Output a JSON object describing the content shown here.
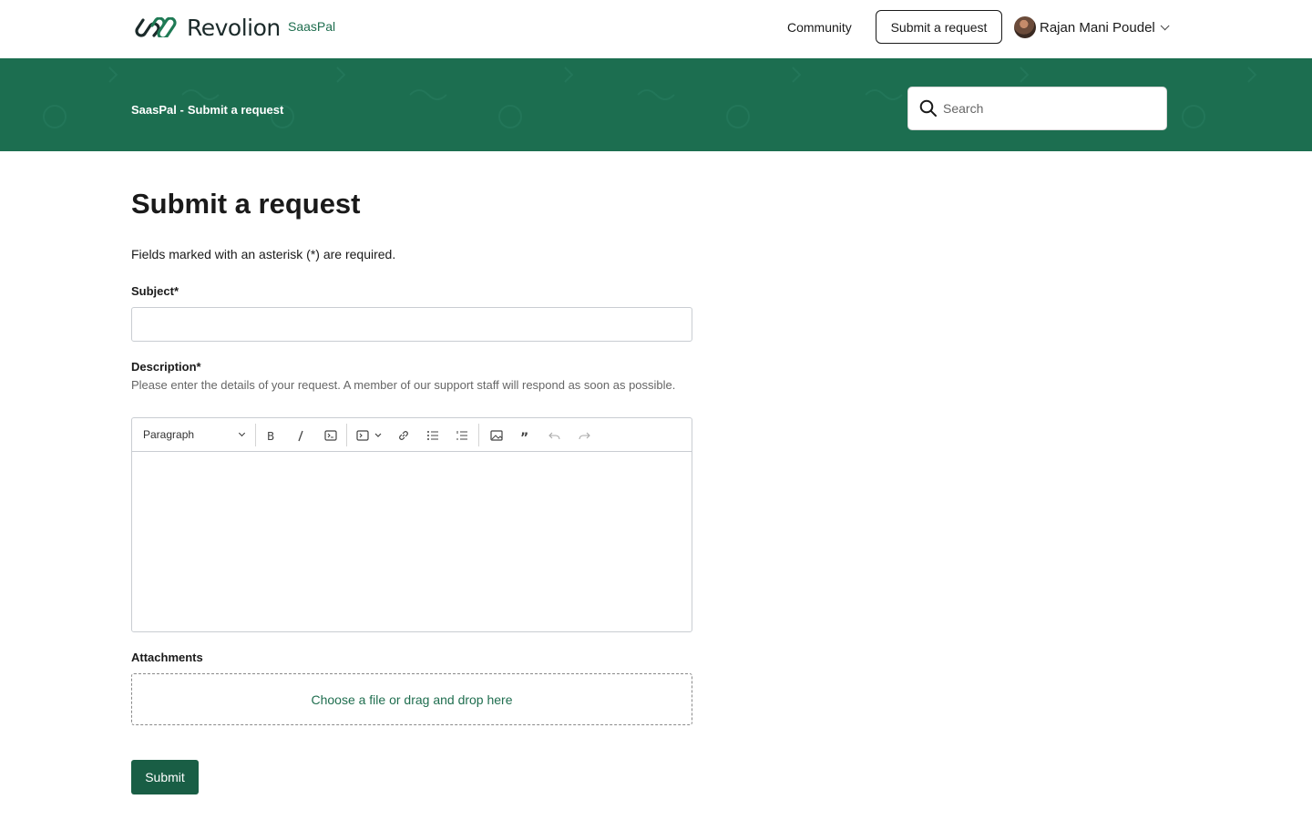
{
  "header": {
    "logo_text": "Revolion",
    "brand_link": "SaasPal",
    "community_link": "Community",
    "submit_request_button": "Submit a request",
    "user_name": "Rajan Mani Poudel"
  },
  "banner": {
    "breadcrumb": [
      "SaasPal -",
      "Submit a request"
    ],
    "search_placeholder": "Search"
  },
  "main": {
    "title": "Submit a request",
    "required_note": "Fields marked with an asterisk (*) are required.",
    "subject_label": "Subject*",
    "subject_value": "",
    "description_label": "Description*",
    "description_hint": "Please enter the details of your request. A member of our support staff will respond as soon as possible.",
    "editor": {
      "block_format": "Paragraph",
      "tools": [
        "bold-icon",
        "italic-icon",
        "code-icon",
        "code-block-icon",
        "link-icon",
        "bulleted-list-icon",
        "numbered-list-icon",
        "image-icon",
        "quote-icon",
        "undo-icon",
        "redo-icon"
      ]
    },
    "attachments_label": "Attachments",
    "dropzone_text": "Choose a file or drag and drop here",
    "submit_label": "Submit"
  },
  "colors": {
    "brand_green": "#1c6e50",
    "button_green": "#195e45",
    "link_green": "#1f6e4f"
  }
}
